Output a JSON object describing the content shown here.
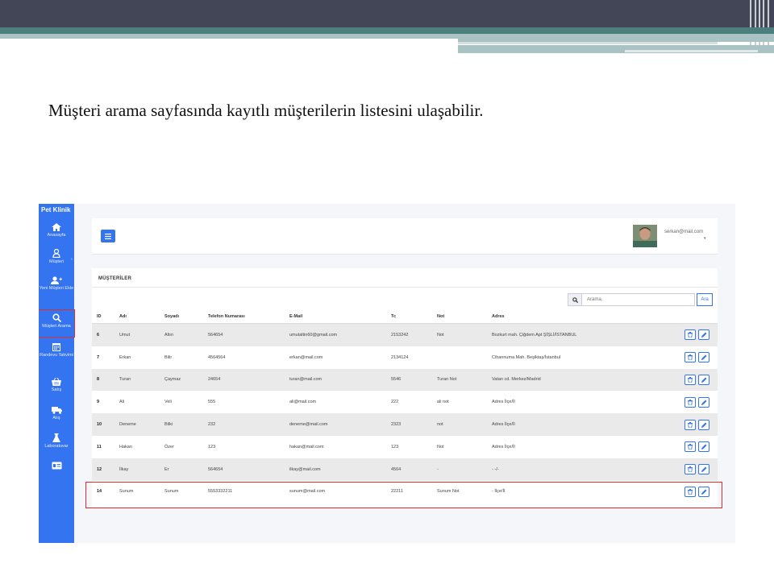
{
  "slide": {
    "caption": "Müşteri arama sayfasında kayıtlı müşterilerin listesini ulaşabilir."
  },
  "colors": {
    "sidebar": "#3574f0",
    "highlight": "#e02b2b",
    "slide_bar": "#434656",
    "slide_band": "#4d7f7f"
  },
  "sidebar": {
    "brand": "Pet Klinik",
    "items": [
      {
        "label": "Anasayfa",
        "icon": "home-icon"
      },
      {
        "label": "Müşteri",
        "icon": "user-icon"
      },
      {
        "label": "Yeni Müşteri Ekle",
        "icon": "user-plus-icon"
      },
      {
        "label": "Müşteri Arama",
        "icon": "search-icon"
      },
      {
        "label": "Randevu Takvimi",
        "icon": "calendar-icon"
      },
      {
        "label": "Satış",
        "icon": "basket-icon"
      },
      {
        "label": "Alış",
        "icon": "truck-icon"
      },
      {
        "label": "Laboratuvar",
        "icon": "flask-icon"
      },
      {
        "label": "",
        "icon": "card-icon"
      }
    ]
  },
  "header": {
    "user_email": "serkan@mail.com"
  },
  "card": {
    "title": "MÜŞTERİLER",
    "search_placeholder": "Arama.",
    "search_button": "Ara"
  },
  "table": {
    "columns": [
      "ID",
      "Adı",
      "Soyadı",
      "Telefon Numarası",
      "E-Mail",
      "Tc",
      "Not",
      "Adres"
    ],
    "rows": [
      [
        "6",
        "Umut",
        "Altın",
        "564654",
        "umutaltin60@gmail.com",
        "2153242",
        "Not",
        "Bozkurt mah. Çiğdem Apt ŞİŞLİ/İSTANBUL"
      ],
      [
        "7",
        "Erkan",
        "Bilir",
        "4564564",
        "erkan@mail.com",
        "2134124",
        "",
        "Cihannuma Mah. Beşiktaş/İstanbul"
      ],
      [
        "8",
        "Turan",
        "Çaymaz",
        "24654",
        "turan@mail.com",
        "5546",
        "Turan Not",
        "Vatan cd. Merkez/Madrid"
      ],
      [
        "9",
        "Ali",
        "Veli",
        "555",
        "ali@mail.com",
        "222",
        "ali not",
        "Adres İlçe/İl"
      ],
      [
        "10",
        "Deneme",
        "Bilki",
        "232",
        "deneme@mail.com",
        "2323",
        "not",
        "Adres İlçe/İl"
      ],
      [
        "11",
        "Hakan",
        "Özer",
        "123",
        "hakan@mail.com",
        "123",
        "Not",
        "Adres İlçe/İl"
      ],
      [
        "12",
        "İlkay",
        "Er",
        "564654",
        "ilkay@mail.com",
        "4564",
        "-",
        "- -/-"
      ],
      [
        "14",
        "Sunum",
        "Sunum",
        "5553332211",
        "sunum@mail.com",
        "22211",
        "Sunum Not",
        "- İlçe/İl"
      ]
    ]
  }
}
